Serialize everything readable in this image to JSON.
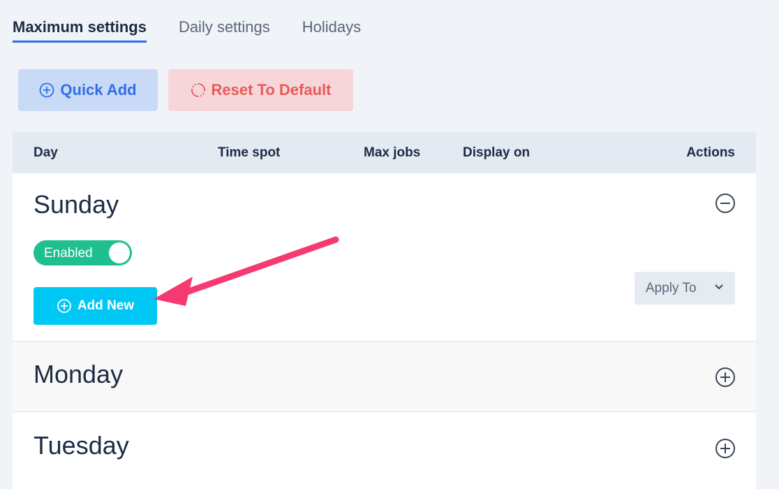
{
  "tabs": [
    {
      "label": "Maximum settings",
      "active": true
    },
    {
      "label": "Daily settings",
      "active": false
    },
    {
      "label": "Holidays",
      "active": false
    }
  ],
  "toolbar": {
    "quick_add_label": "Quick Add",
    "reset_label": "Reset To Default"
  },
  "table": {
    "headers": {
      "day": "Day",
      "time_spot": "Time spot",
      "max_jobs": "Max jobs",
      "display_on": "Display on",
      "actions": "Actions"
    }
  },
  "days": {
    "sunday": {
      "name": "Sunday",
      "expanded": true,
      "toggle_label": "Enabled",
      "add_new_label": "Add New",
      "apply_to_label": "Apply To"
    },
    "monday": {
      "name": "Monday",
      "expanded": false
    },
    "tuesday": {
      "name": "Tuesday",
      "expanded": false
    }
  },
  "icons": {
    "quick_add": "plus-circle-icon",
    "reset": "refresh-icon",
    "collapse": "minus-circle-icon",
    "expand": "plus-circle-icon",
    "dropdown": "chevron-down-icon",
    "annotation": "arrow-annotation"
  },
  "colors": {
    "accent": "#2f6fe6",
    "danger": "#e85a5a",
    "success": "#1fbf8f",
    "cyan": "#00c8f5",
    "annotation": "#f53a72"
  }
}
